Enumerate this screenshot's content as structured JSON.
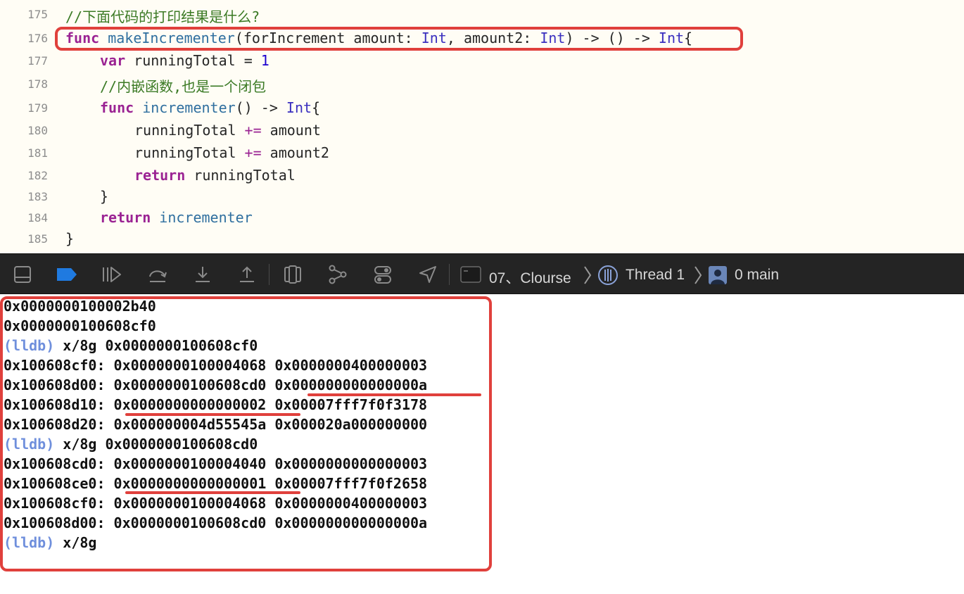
{
  "editor": {
    "lines": [
      {
        "num": "175",
        "comment": "//下面代码的打印结果是什么?"
      },
      {
        "num": "176",
        "kw_func": "func",
        "name": "makeIncrementer",
        "p1": "(forIncrement amount: ",
        "t1": "Int",
        "p2": ", amount2: ",
        "t2": "Int",
        "p3": ") -> () -> ",
        "t3": "Int",
        "p4": "{"
      },
      {
        "num": "177",
        "kw": "var",
        "rest": " runningTotal = ",
        "value": "1"
      },
      {
        "num": "178",
        "comment": "//内嵌函数,也是一个闭包"
      },
      {
        "num": "179",
        "kw": "func",
        "name": "incrementer",
        "rest": "() -> ",
        "type": "Int",
        "tail": "{"
      },
      {
        "num": "180",
        "var": "runningTotal ",
        "op": "+=",
        "rest": " amount"
      },
      {
        "num": "181",
        "var": "runningTotal ",
        "op": "+=",
        "rest": " amount2"
      },
      {
        "num": "182",
        "kw": "return",
        "rest": " runningTotal"
      },
      {
        "num": "183",
        "text": "}"
      },
      {
        "num": "184",
        "kw": "return",
        "name": "incrementer"
      },
      {
        "num": "185",
        "text": "}"
      }
    ]
  },
  "toolbar": {
    "icons": [
      "hide-debug-area-icon",
      "breakpoints-icon",
      "continue-icon",
      "step-over-icon",
      "step-into-icon",
      "step-out-icon",
      "view-debugger-icon",
      "memory-graph-icon",
      "environment-overrides-icon",
      "simulate-location-icon"
    ],
    "breadcrumb": {
      "target": "07、Clourse",
      "thread": "Thread 1",
      "frame": "0 main"
    },
    "accent": "#1f7ae0"
  },
  "console": {
    "lines": [
      {
        "text": "0x0000000100002b40"
      },
      {
        "text": "0x0000000100608cf0"
      },
      {
        "prompt": "(lldb)",
        "cmd": " x/8g 0x0000000100608cf0"
      },
      {
        "addr": "0x100608cf0: ",
        "v1": "0x0000000100004068",
        "v2": "0x0000000400000003"
      },
      {
        "addr": "0x100608d00: ",
        "v1": "0x0000000100608cd0",
        "v2": "0x000000000000000a"
      },
      {
        "addr": "0x100608d10: ",
        "v1": "0x0000000000000002",
        "v2": "0x00007fff7f0f3178"
      },
      {
        "addr": "0x100608d20: ",
        "v1": "0x000000004d55545a",
        "v2": "0x000020a000000000"
      },
      {
        "prompt": "(lldb)",
        "cmd": " x/8g 0x0000000100608cd0"
      },
      {
        "addr": "0x100608cd0: ",
        "v1": "0x0000000100004040",
        "v2": "0x0000000000000003"
      },
      {
        "addr": "0x100608ce0: ",
        "v1": "0x0000000000000001",
        "v2": "0x00007fff7f0f2658"
      },
      {
        "addr": "0x100608cf0: ",
        "v1": "0x0000000100004068",
        "v2": "0x0000000400000003"
      },
      {
        "addr": "0x100608d00: ",
        "v1": "0x0000000100608cd0",
        "v2": "0x000000000000000a"
      },
      {
        "prompt": "(lldb)",
        "cmd": " x/8g"
      }
    ]
  },
  "annotation_color": "#e0403c"
}
